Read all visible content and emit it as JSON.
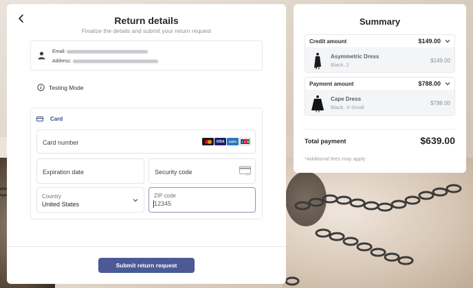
{
  "return_details": {
    "title": "Return details",
    "subtitle": "Finalize the details and submit your return request",
    "contact": {
      "email_label": "Email:",
      "address_label": "Address:"
    },
    "testing_mode": "Testing Mode",
    "card_section": {
      "heading": "Card",
      "card_number_label": "Card number",
      "brands": [
        "mastercard",
        "visa",
        "amex",
        "jcb"
      ],
      "expiration_label": "Expiration date",
      "security_code_label": "Security code",
      "country_label": "Country",
      "country_value": "United States",
      "zip_label": "ZIP code",
      "zip_value": "12345"
    },
    "submit_label": "Submit return request"
  },
  "summary": {
    "title": "Summary",
    "credit": {
      "label": "Credit amount",
      "amount": "$149.00",
      "item": {
        "name": "Asymmetric Dress",
        "variant": "Black, 2",
        "price": "$149.00"
      }
    },
    "payment": {
      "label": "Payment amount",
      "amount": "$788.00",
      "item": {
        "name": "Cape Dress",
        "variant": "Black, X-Small",
        "price": "$788.00"
      }
    },
    "total_label": "Total payment",
    "total_amount": "$639.00",
    "fees_note": "*Additional fees may apply"
  },
  "colors": {
    "primary": "#4b5a96",
    "card_accent": "#3b4b8a"
  }
}
